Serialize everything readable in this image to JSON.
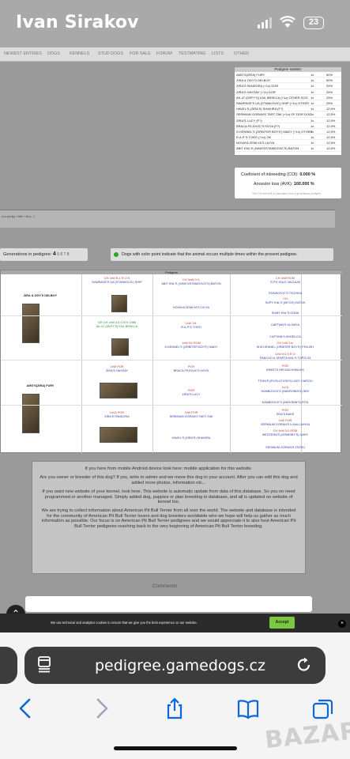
{
  "status": {
    "owner": "Ivan Sirakov",
    "battery": "23"
  },
  "nav": [
    "NEWEST ENTRIES",
    "DOGS",
    "KENNELS",
    "STUD DOGS",
    "FOR SALE",
    "FORUM",
    "TESTMATING",
    "LISTS",
    "OTHER"
  ],
  "stats": {
    "title": "Pedigree statistic",
    "rows": [
      [
        "AMG'S(ZIRA) FURY",
        "1x",
        "50%"
      ],
      [
        "ZIRA & ODY'S DELBOY",
        "1x",
        "50%"
      ],
      [
        "ZIRA'S PANDORA (+1x) DOR",
        "1x",
        "25%"
      ],
      [
        "ZIRA'S HAYDAY (+1x) DOR",
        "1x",
        "25%"
      ],
      [
        "AK-47 (DEFY'S) KNL BRSKCA (+1x) OTHER DOG",
        "1x",
        "25%"
      ],
      [
        "RAMPAGE'S UA (STANKOVIC) SHIP (+1x) OTHER",
        "1x",
        "25%"
      ],
      [
        "HAVEL'S (ZIRA'S) SHAKIRA (F?)",
        "1x",
        "12,5%"
      ],
      [
        "SERMIUM GORAN'S TART-TAK (+1x) OF DOR DOG",
        "1x",
        "12,5%"
      ],
      [
        "ZIRA'S LUCY (F?)",
        "1x",
        "12,5%"
      ],
      [
        "BRACA FEJOVIC'S HOYA (F?)",
        "1x",
        "12,5%"
      ],
      [
        "G.KENNEL'S (ORBITER BOYS') MADY (+1x) OTHER",
        "1x",
        "12,5%"
      ],
      [
        "R.A.P.'S TORO (+1x) OK",
        "1x",
        "12,5%"
      ],
      [
        "NOVAYA ZEMLYA'S LILIYA",
        "1x",
        "12,5%"
      ],
      [
        "ABIT KNL'S (IVAN'S/STANKOVIC'S) BATON",
        "1x",
        "12,5%"
      ]
    ]
  },
  "coi": {
    "line1_label": "Coeficient of inbreeding (COI):",
    "line1_value": "0.000 %",
    "line2_label": "Ancestor loss (AVK):",
    "line2_value": "100.000 %",
    "note": "The COI and AVK is calculated from 4 generations pedigree"
  },
  "comments_bar": "(no pedig. / title / fd-s...)",
  "generations": {
    "label": "Generations in pedigree:",
    "current": "4",
    "others": "5 6 7 8"
  },
  "dup_note": "Dogs with color point indicate that the animal occurs multiple times within the present pedigree.",
  "pedigree": {
    "title": "Pedigree",
    "gen1": [
      {
        "name": "ZIRA & ODY'S DELBOY"
      },
      {
        "name": "AMG'S(ZIRA) FURY"
      }
    ],
    "gen2": [
      {
        "meta": "CH 1xW B-1 R.O.S",
        "name": "RAMPAGE'S UA (STANKOVIC) SHIP"
      },
      {
        "meta": "GR CH 1xW 3,5 O.B.S 1986",
        "name": "AK-47 (DEFY'S) KNL BRSKCA"
      },
      {
        "meta": "2xW POR",
        "name": "ZIRA'S HAYDAY"
      },
      {
        "meta": "1xLD POR",
        "name": "ZIRA'S PANDORA"
      }
    ],
    "gen3": [
      {
        "meta": "CH 3xW 0+1",
        "name": "ABIT KNL'S (IVAN'S/STANKOVIC'S) BATON"
      },
      {
        "meta": "",
        "name": "NOVAYA ZEMLYA'S LILIYA"
      },
      {
        "meta": "1xW 1xL",
        "name": "R.A.P.'S TORO"
      },
      {
        "meta": "1xW 0/1 ROM",
        "name": "G.KENNEL'S (ORBITER BOYS') MADY"
      },
      {
        "meta": "POR",
        "name": "BRACA FEJOVIC'S HOYA"
      },
      {
        "meta": "POR",
        "name": "ZIRA'S LUCY"
      },
      {
        "meta": "2xW POR",
        "name": "SERMIUM GORAN'S TART-TAK"
      },
      {
        "meta": "",
        "name": "HAVEL'S (ZIRA'S) SHAKIRA"
      }
    ],
    "gen4": [
      {
        "meta": "CH 3xW ROM",
        "name": "R.P.E KNLS VACUUM"
      },
      {
        "meta": "",
        "name": "STANKOVIC'S TSCHIKA"
      },
      {
        "meta": "CH",
        "name": "SUPY KNL'S (MYCH) EATON"
      },
      {
        "meta": "",
        "name": "SUMY KNL'S DONA"
      },
      {
        "meta": "",
        "name": "CAPTAIN'S KLOMYA"
      },
      {
        "meta": "",
        "name": "CAPTAIN'S ANGELICA"
      },
      {
        "meta": "CH 1xW 1xL",
        "name": "M.M KENNEL (ORBITER BOYS') PHILISH"
      },
      {
        "meta": "1xW 0/1 S.R.O",
        "name": "PANCHO & SPARTA KNL'S TOPSI 33"
      },
      {
        "meta": "POR",
        "name": "KBIBTI'S MR MACHOBUCK"
      },
      {
        "meta": "",
        "name": "TITAN'S (EVOLUTION'S) LADY CAIROU"
      },
      {
        "meta": "1xLD",
        "name": "KAMBOOCK'S (ANDROBIN'S) SBV"
      },
      {
        "meta": "",
        "name": "KAMBOOCK'S (ANROBIN'S) RITA"
      },
      {
        "meta": "POR",
        "name": "ZIVA'S BAKE"
      },
      {
        "meta": "1xW POR",
        "name": "SERMIUM GORAN'S LUNA-LUKKIA"
      },
      {
        "meta": "CH 4xW 0/1 ROM",
        "name": "WESTERN'S (GRIMSBY'S) GARY"
      },
      {
        "meta": "",
        "name": "SERMIUM GORAN'S ZSZSU"
      }
    ]
  },
  "info": [
    "If you here from mobile Android device look here: mobile application for this website.",
    "Are you owner or breeder of this dog? If yes, write to admin and we move this dog to your account. After you can edit this dog and added more photos, information etc...",
    "If you want new website of your kennel, look here. This website is automatic update from data of this database. So you no need programmed or another managed. Simply added dog, puppies or plan breeding to database, and all is updated on website of kennel too.",
    "We are trying to collect information about American Pit Bull Terrier from all over the world. The website and database is intended for the community of American Pit Bull Terrier lovers and dog breeders worldwide who we hope will help us gather as much information as possible. Our focus is on American Pit Bull Terrier pedigrees and we would appreciate it to also host American Pit Bull Terrier pedigrees reaching back to the very beginning of American Pit Bull Terrier breeding."
  ],
  "comments_label": "Comments",
  "cookie": {
    "text": "We use technical and analytics cookies to ensure that we give you the best experience on our website.",
    "accept": "Accept"
  },
  "browser": {
    "url": "pedigree.gamedogs.cz"
  },
  "watermark": "BAZAR"
}
